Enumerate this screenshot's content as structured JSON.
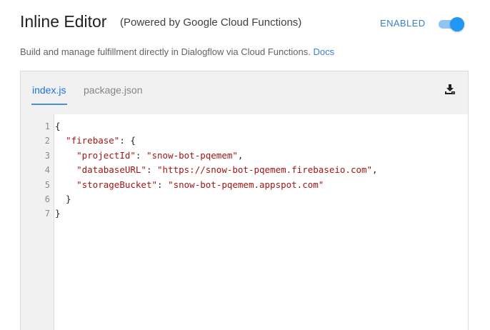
{
  "header": {
    "title": "Inline Editor",
    "subtitle": "(Powered by Google Cloud Functions)",
    "status_label": "ENABLED",
    "toggle_on": true
  },
  "description": {
    "text": "Build and manage fulfillment directly in Dialogflow via Cloud Functions.",
    "link_label": "Docs"
  },
  "editor": {
    "tabs": [
      {
        "label": "index.js",
        "active": true
      },
      {
        "label": "package.json",
        "active": false
      }
    ],
    "download_icon": "download-icon",
    "line_numbers": [
      "1",
      "2",
      "3",
      "4",
      "5",
      "6",
      "7"
    ],
    "code_lines": [
      "{",
      "  \"firebase\": {",
      "    \"projectId\": \"snow-bot-pqemem\",",
      "    \"databaseURL\": \"https://snow-bot-pqemem.firebaseio.com\",",
      "    \"storageBucket\": \"snow-bot-pqemem.appspot.com\"",
      "  }",
      "}"
    ]
  },
  "colors": {
    "accent": "#1a73e8",
    "toggle_knob": "#2196f3",
    "toggle_track": "#8fc4f5",
    "string": "#a31515"
  }
}
